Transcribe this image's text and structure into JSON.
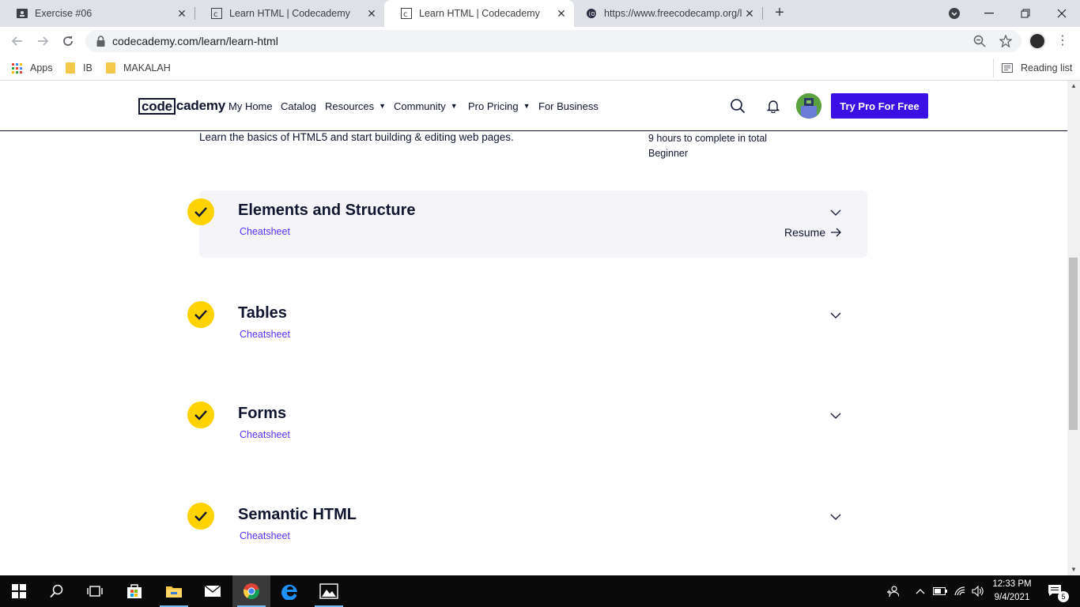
{
  "browser": {
    "tabs": [
      {
        "title": "Exercise #06",
        "active": false
      },
      {
        "title": "Learn HTML | Codecademy",
        "active": false
      },
      {
        "title": "Learn HTML | Codecademy",
        "active": true
      },
      {
        "title": "https://www.freecodecamp.org/le",
        "active": false
      }
    ],
    "url": "codecademy.com/learn/learn-html",
    "bookmarks": [
      "Apps",
      "IB",
      "MAKALAH"
    ],
    "reading_list": "Reading list"
  },
  "site": {
    "logo_box": "code",
    "logo_rest": "cademy",
    "nav": {
      "my_home": "My Home",
      "catalog": "Catalog",
      "resources": "Resources",
      "community": "Community",
      "pro_pricing": "Pro Pricing",
      "for_business": "For Business"
    },
    "cta": "Try Pro For Free"
  },
  "course": {
    "description": "Learn the basics of HTML5 and start building & editing web pages.",
    "duration": "9 hours to complete in total",
    "level": "Beginner"
  },
  "modules": [
    {
      "title": "Elements and Structure",
      "link": "Cheatsheet",
      "completed": true,
      "highlighted": true,
      "action": "Resume"
    },
    {
      "title": "Tables",
      "link": "Cheatsheet",
      "completed": true
    },
    {
      "title": "Forms",
      "link": "Cheatsheet",
      "completed": true
    },
    {
      "title": "Semantic HTML",
      "link": "Cheatsheet",
      "completed": true
    }
  ],
  "taskbar": {
    "time": "12:33 PM",
    "date": "9/4/2021",
    "notifications": "5"
  },
  "colors": {
    "brand_primary": "#3a10e5",
    "check_yellow": "#ffd300",
    "link_purple": "#5533ff",
    "navy": "#10162f"
  }
}
